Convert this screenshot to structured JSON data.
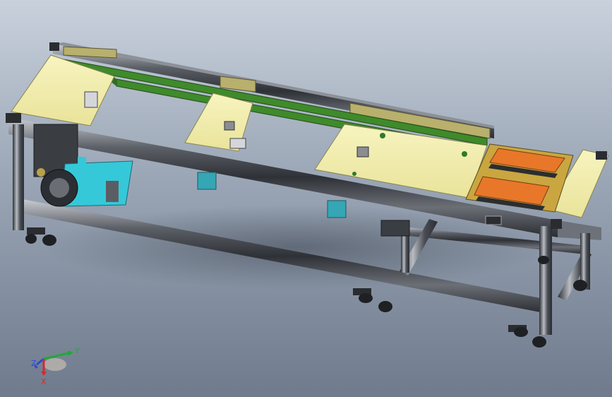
{
  "viewport": {
    "background_top": "#c9d1dc",
    "background_bottom": "#6f7b8c"
  },
  "model": {
    "frame_color": "#3a3d42",
    "frame_highlight": "#9aa0a8",
    "plate_color": "#f1eda6",
    "belt_color": "#3f8a2b",
    "pcb_color": "#e8772a",
    "motor_color": "#35c8d8",
    "caster_color": "#2a2c30"
  },
  "triad": {
    "x_label": "X",
    "y_label": "Y",
    "z_label": "Z",
    "x_color": "#d42a2a",
    "y_color": "#22a83a",
    "z_color": "#2a4bd4"
  }
}
